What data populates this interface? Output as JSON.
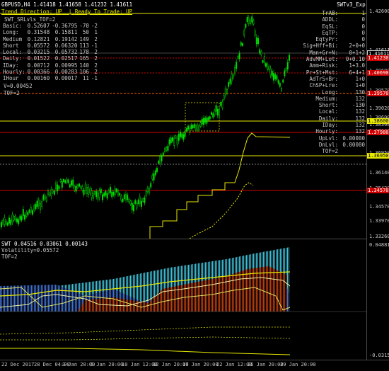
{
  "chart": {
    "symbol_title": "GBPUSD,H4  1.41418 1.41658 1.41232 1.41611",
    "indicator_title": "SWTv3_Exp",
    "trend_label": "Trend Direction",
    "trend_value": "UP",
    "ready_label": "Ready To Trade",
    "ready_value": "UP",
    "srlvls": "SWT_SRLvls_TOF=2"
  },
  "hud_rows": [
    {
      "name": "Basic:",
      "a": "0.52607",
      "b": "-0.36795",
      "c": "-70",
      "d": "-2"
    },
    {
      "name": "Long:",
      "a": "0.31548",
      "b": "0.15811",
      "c": "50",
      "d": "1"
    },
    {
      "name": "Medium",
      "a": "0.12821",
      "b": "0.19142",
      "c": "149",
      "d": "2"
    },
    {
      "name": "Short",
      "a": "0.05572",
      "b": "0.06320",
      "c": "113",
      "d": "-1"
    },
    {
      "name": "Local:",
      "a": "0.03215",
      "b": "0.05732",
      "c": "178",
      "d": "2"
    },
    {
      "name": "Daily:",
      "a": "0.01522",
      "b": "0.02517",
      "c": "165",
      "d": "2"
    },
    {
      "name": "IDay:",
      "a": "0.00712",
      "b": "0.00995",
      "c": "140",
      "d": "2"
    },
    {
      "name": "Hourly:",
      "a": "0.00366",
      "b": "0.00283",
      "c": "106",
      "d": "2"
    },
    {
      "name": "IHour",
      "a": "0.00160",
      "b": "0.00017",
      "c": "11",
      "d": "-1"
    }
  ],
  "hud_extra": [
    "V=0.00452",
    "TOF=2"
  ],
  "right_panel": [
    {
      "label": "TrAB:",
      "value": "1"
    },
    {
      "label": "ADDL:",
      "value": "0"
    },
    {
      "label": "EqSL:",
      "value": "0"
    },
    {
      "label": "EqTP:",
      "value": "0"
    },
    {
      "label": "EqtyPr:",
      "value": "0"
    },
    {
      "label": "Sig+Hff+Bi:",
      "value": "2+0+0"
    },
    {
      "label": "Man+Gr+N:",
      "value": "0+1+2"
    },
    {
      "label": "AdvMM+Lot:",
      "value": "0+0.10"
    },
    {
      "label": "Amm+Risk:",
      "value": "1+3.0"
    },
    {
      "label": "Pr+St+Mst:",
      "value": "6+4+1"
    },
    {
      "label": "AdTrS+Br:",
      "value": "1+0"
    },
    {
      "label": "ChSP+Lre:",
      "value": "1+0"
    },
    {
      "label": "Long:",
      "value": "130"
    },
    {
      "label": "Medium:",
      "value": "132"
    },
    {
      "label": "Short:",
      "value": "-130"
    },
    {
      "label": "Local:",
      "value": "132"
    },
    {
      "label": "Daily:",
      "value": "132"
    },
    {
      "label": "IDay:",
      "value": "132"
    },
    {
      "label": "Hourly:",
      "value": "132"
    },
    {
      "label": "UpLvl:",
      "value": "0.00000"
    },
    {
      "label": "DnLvl:",
      "value": "0.00000"
    },
    {
      "label": "TOF=2",
      "value": ""
    }
  ],
  "yaxis_main": [
    "1.42600",
    "1.41611",
    "1.41230",
    "1.40690",
    "1.39570",
    "1.39020",
    "1.38600",
    "1.38300",
    "1.37980",
    "1.36950",
    "1.36140",
    "1.35420",
    "1.34570",
    "1.33970",
    "1.33260"
  ],
  "tags": [
    {
      "text": "1.41611",
      "color": "#ffffff",
      "bg": "#000000"
    },
    {
      "text": "1.41230",
      "color": "#ffffff",
      "bg": "#d00000"
    },
    {
      "text": "1.40690",
      "color": "#ffffff",
      "bg": "#d00000"
    },
    {
      "text": "1.39570",
      "color": "#ffffff",
      "bg": "#d00000"
    },
    {
      "text": "1.38600",
      "color": "#000000",
      "bg": "#e8e800"
    },
    {
      "text": "1.37980",
      "color": "#ffffff",
      "bg": "#d00000"
    },
    {
      "text": "1.36950",
      "color": "#000000",
      "bg": "#e8e800"
    },
    {
      "text": "1.34570",
      "color": "#ffffff",
      "bg": "#d00000"
    }
  ],
  "sub": {
    "title": "SWT 0.04516 0.03061 0.00143",
    "volatility": "Volatility=0.05572",
    "tof": "TOF=2",
    "ymax": "0.04881",
    "ymin": "-0.03151"
  },
  "xaxis": [
    "22 Dec 2017",
    "28 Dec 04:00",
    "3 Jan 20:00",
    "5 Jan 20:00",
    "10 Jan 12:00",
    "12 Jan 20:00",
    "17 Jan 20:00",
    "22 Jan 12:00",
    "25 Jan 20:00",
    "29 Jan 20:00"
  ],
  "colors": {
    "candle": "#00e000",
    "grid": "#303030",
    "yellow": "#e8e800",
    "red": "#d00000",
    "orange": "#ff8040"
  }
}
